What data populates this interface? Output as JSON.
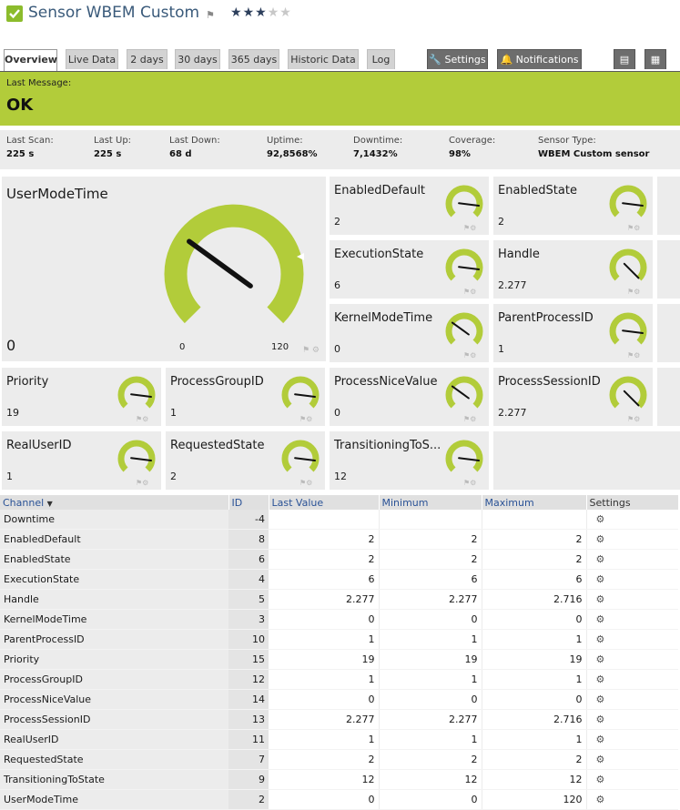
{
  "header": {
    "title": "Sensor WBEM Custom",
    "flag_icon": "flag-icon",
    "stars_filled": 3,
    "stars_total": 5,
    "accent": "#8cbc2c"
  },
  "tabs": [
    {
      "label": "Overview",
      "active": true
    },
    {
      "label": "Live Data"
    },
    {
      "label": "2 days"
    },
    {
      "label": "30 days"
    },
    {
      "label": "365 days"
    },
    {
      "label": "Historic Data"
    },
    {
      "label": "Log"
    },
    {
      "label": "Settings",
      "icon": "wrench-icon"
    },
    {
      "label": "Notifications",
      "icon": "bell-icon"
    },
    {
      "label": "",
      "icon": "comment-icon"
    },
    {
      "label": "",
      "icon": "book-icon"
    }
  ],
  "last_message": {
    "label": "Last Message:",
    "value": "OK",
    "color": "#b2cc3a"
  },
  "stats": [
    {
      "label": "Last Scan:",
      "value": "225 s"
    },
    {
      "label": "Last Up:",
      "value": "225 s"
    },
    {
      "label": "Last Down:",
      "value": "68 d"
    },
    {
      "label": "Uptime:",
      "value": "92,8568%"
    },
    {
      "label": "Downtime:",
      "value": "7,1432%"
    },
    {
      "label": "Coverage:",
      "value": "98%"
    },
    {
      "label": "Sensor Type:",
      "value": "WBEM Custom sensor"
    }
  ],
  "big_gauge": {
    "name": "UserModeTime",
    "value_label": "0",
    "min_label": "0",
    "max_label": "120",
    "gauge_fraction": 0.3
  },
  "gauges": [
    {
      "name": "EnabledDefault",
      "value": "2",
      "fraction": 0.86
    },
    {
      "name": "EnabledState",
      "value": "2",
      "fraction": 0.86
    },
    {
      "name": "ExecutionState",
      "value": "6",
      "fraction": 0.86
    },
    {
      "name": "Handle",
      "value": "2.277",
      "fraction": 1.0
    },
    {
      "name": "KernelModeTime",
      "value": "0",
      "fraction": 0.3
    },
    {
      "name": "ParentProcessID",
      "value": "1",
      "fraction": 0.86
    },
    {
      "name": "Priority",
      "value": "19",
      "fraction": 0.86
    },
    {
      "name": "ProcessGroupID",
      "value": "1",
      "fraction": 0.86
    },
    {
      "name": "ProcessNiceValue",
      "value": "0",
      "fraction": 0.3
    },
    {
      "name": "ProcessSessionID",
      "value": "2.277",
      "fraction": 1.0
    },
    {
      "name": "RealUserID",
      "value": "1",
      "fraction": 0.86
    },
    {
      "name": "RequestedState",
      "value": "2",
      "fraction": 0.86
    },
    {
      "name": "TransitioningToS...",
      "value": "12",
      "fraction": 0.86
    }
  ],
  "channels": {
    "headers": [
      "Channel",
      "ID",
      "Last Value",
      "Minimum",
      "Maximum",
      "Settings"
    ],
    "rows": [
      [
        "Downtime",
        "-4",
        "",
        "",
        ""
      ],
      [
        "EnabledDefault",
        "8",
        "2",
        "2",
        "2"
      ],
      [
        "EnabledState",
        "6",
        "2",
        "2",
        "2"
      ],
      [
        "ExecutionState",
        "4",
        "6",
        "6",
        "6"
      ],
      [
        "Handle",
        "5",
        "2.277",
        "2.277",
        "2.716"
      ],
      [
        "KernelModeTime",
        "3",
        "0",
        "0",
        "0"
      ],
      [
        "ParentProcessID",
        "10",
        "1",
        "1",
        "1"
      ],
      [
        "Priority",
        "15",
        "19",
        "19",
        "19"
      ],
      [
        "ProcessGroupID",
        "12",
        "1",
        "1",
        "1"
      ],
      [
        "ProcessNiceValue",
        "14",
        "0",
        "0",
        "0"
      ],
      [
        "ProcessSessionID",
        "13",
        "2.277",
        "2.277",
        "2.716"
      ],
      [
        "RealUserID",
        "11",
        "1",
        "1",
        "1"
      ],
      [
        "RequestedState",
        "7",
        "2",
        "2",
        "2"
      ],
      [
        "TransitioningToState",
        "9",
        "12",
        "12",
        "12"
      ],
      [
        "UserModeTime",
        "2",
        "0",
        "0",
        "120"
      ]
    ]
  }
}
